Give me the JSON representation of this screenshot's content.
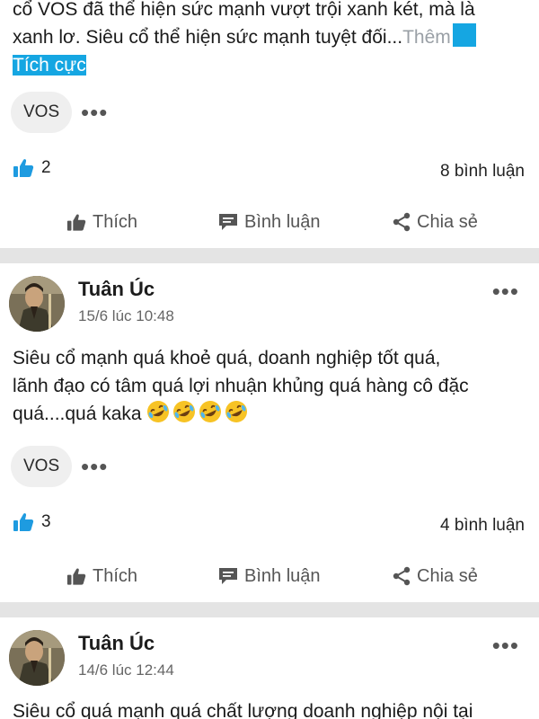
{
  "post1": {
    "text_lines": [
      "cổ VOS đã thể hiện sức mạnh vượt trội xanh két, mà là",
      "xanh lơ. Siêu cổ thể hiện sức mạnh tuyệt đối..."
    ],
    "more_label": "Thêm",
    "highlight_text": "Tích cực",
    "tag": "VOS",
    "likes": "2",
    "comments": "8 bình luận"
  },
  "actions": {
    "like": "Thích",
    "comment": "Bình luận",
    "share": "Chia sẻ"
  },
  "post2": {
    "author": "Tuân Úc",
    "time": "15/6 lúc 10:48",
    "text_lines": [
      "Siêu cổ mạnh quá khoẻ quá, doanh nghiệp tốt quá,",
      "lãnh đạo có tâm quá lợi nhuận khủng quá hàng cô đặc",
      "quá....quá kaka"
    ],
    "emoji": "rolling-on-floor-laughing x4",
    "tag": "VOS",
    "likes": "3",
    "comments": "4 bình luận"
  },
  "post3": {
    "author": "Tuân Úc",
    "time": "14/6 lúc 12:44",
    "text_partial": "Siêu cổ quá mạnh quá chất lượng doanh nghiệp nội tại"
  },
  "colors": {
    "accent_blue": "#15a6e2",
    "divider": "#e4e4e4",
    "chip_bg": "#efefef"
  }
}
